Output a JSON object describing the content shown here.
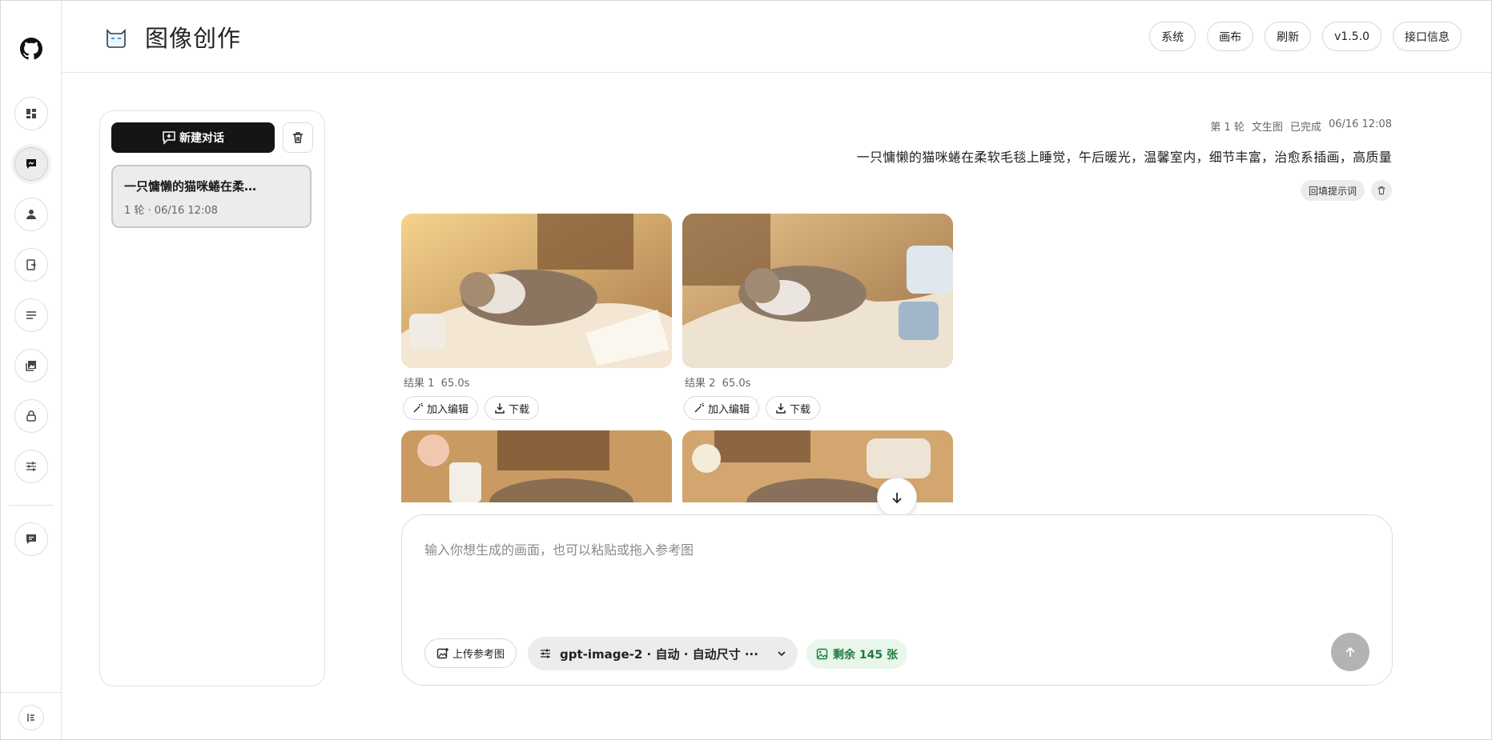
{
  "header": {
    "title": "图像创作",
    "buttons": [
      "系统",
      "画布",
      "刷新",
      "v1.5.0",
      "接口信息"
    ]
  },
  "sidebar": {
    "items": [
      {
        "icon": "dashboard-icon"
      },
      {
        "icon": "chat-icon",
        "active": true
      },
      {
        "icon": "user-icon"
      },
      {
        "icon": "document-icon"
      },
      {
        "icon": "list-icon"
      },
      {
        "icon": "gallery-icon"
      },
      {
        "icon": "lock-icon"
      },
      {
        "icon": "settings-sliders-icon"
      },
      {
        "icon": "message-icon"
      }
    ]
  },
  "conversations": {
    "new_chat_label": "新建对话",
    "items": [
      {
        "title": "一只慵懒的猫咪蜷在柔…",
        "meta": "1 轮 · 06/16 12:08"
      }
    ]
  },
  "turn": {
    "round": "第 1 轮",
    "mode": "文生图",
    "status": "已完成",
    "time": "06/16 12:08",
    "prompt": "一只慵懒的猫咪蜷在柔软毛毯上睡觉，午后暖光，温馨室内，细节丰富，治愈系插画，高质量",
    "refill_label": "回填提示词"
  },
  "results": [
    {
      "label": "结果 1",
      "duration": "65.0s",
      "add_edit": "加入编辑",
      "download": "下载"
    },
    {
      "label": "结果 2",
      "duration": "65.0s",
      "add_edit": "加入编辑",
      "download": "下载"
    }
  ],
  "composer": {
    "placeholder": "输入你想生成的画面，也可以粘贴或拖入参考图",
    "upload_label": "上传参考图",
    "model_label": "gpt-image-2 · 自动 · 自动尺寸 ···",
    "quota_label": "剩余 145 张"
  },
  "colors": {
    "primary": "#151515",
    "quota_bg": "#e9f6ec",
    "quota_text": "#1f7a3a",
    "send_disabled": "#b3b3b3"
  }
}
